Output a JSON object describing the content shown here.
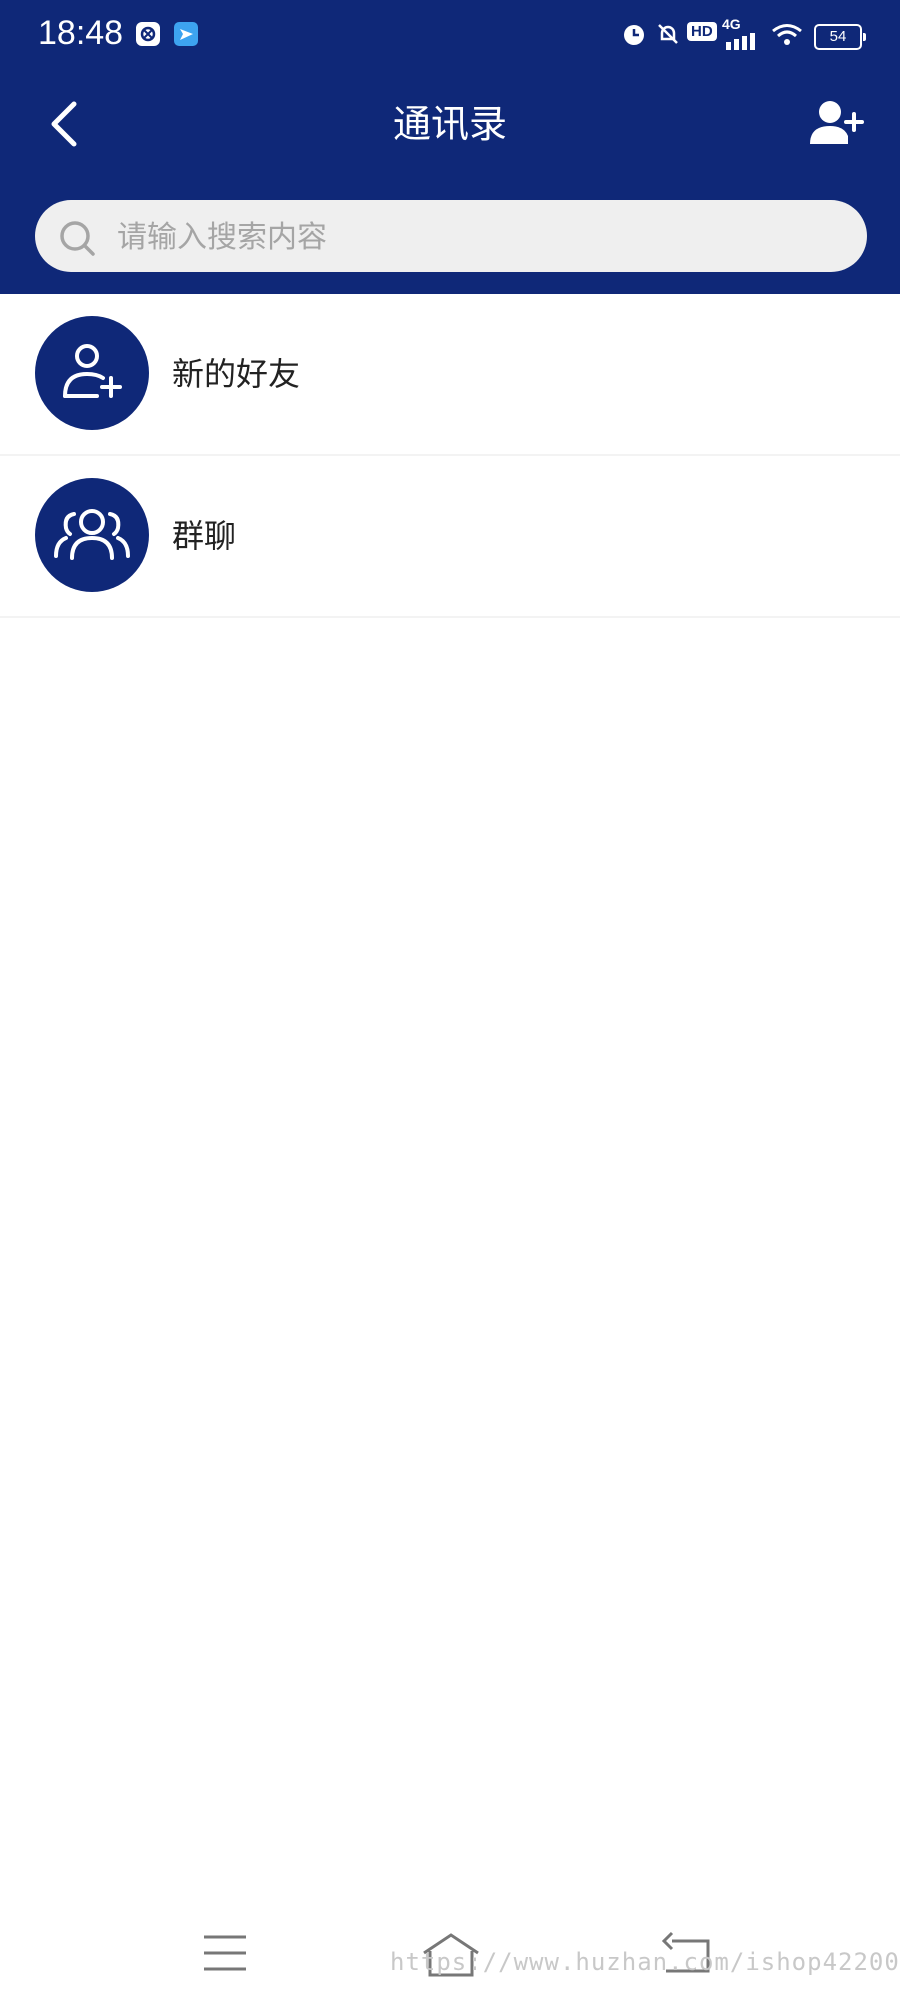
{
  "status_bar": {
    "time": "18:48",
    "network": "4G",
    "hd_badge": "HD",
    "battery": "54"
  },
  "header": {
    "title": "通讯录",
    "back_icon": "chevron-left-icon",
    "add_icon": "add-contact-icon"
  },
  "search": {
    "placeholder": "请输入搜索内容",
    "value": ""
  },
  "list": {
    "items": [
      {
        "label": "新的好友",
        "icon": "person-add-icon"
      },
      {
        "label": "群聊",
        "icon": "group-icon"
      }
    ]
  },
  "watermark": "https://www.huzhan.com/ishop42200",
  "colors": {
    "header_bg": "#0f2878",
    "search_bg": "#efefef",
    "avatar_bg": "#0f2878"
  }
}
